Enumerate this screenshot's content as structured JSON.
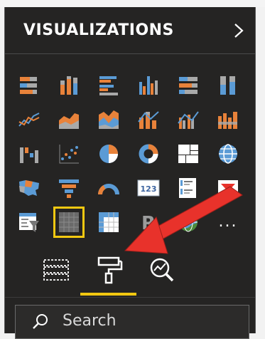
{
  "panel": {
    "title": "VISUALIZATIONS",
    "collapse_icon": "chevron-right-icon"
  },
  "visuals": [
    {
      "name": "stacked-bar-chart-icon"
    },
    {
      "name": "stacked-column-chart-icon"
    },
    {
      "name": "clustered-bar-chart-icon"
    },
    {
      "name": "clustered-column-chart-icon"
    },
    {
      "name": "100-percent-stacked-bar-chart-icon"
    },
    {
      "name": "100-percent-stacked-column-chart-icon"
    },
    {
      "name": "line-chart-icon"
    },
    {
      "name": "area-chart-icon"
    },
    {
      "name": "stacked-area-chart-icon"
    },
    {
      "name": "line-and-stacked-column-chart-icon"
    },
    {
      "name": "line-and-clustered-column-chart-icon"
    },
    {
      "name": "ribbon-chart-icon"
    },
    {
      "name": "waterfall-chart-icon"
    },
    {
      "name": "scatter-chart-icon"
    },
    {
      "name": "pie-chart-icon"
    },
    {
      "name": "donut-chart-icon"
    },
    {
      "name": "treemap-icon"
    },
    {
      "name": "map-icon"
    },
    {
      "name": "filled-map-icon"
    },
    {
      "name": "funnel-icon"
    },
    {
      "name": "gauge-icon"
    },
    {
      "name": "card-icon",
      "text": "123"
    },
    {
      "name": "multi-row-card-icon"
    },
    {
      "name": "kpi-icon"
    },
    {
      "name": "slicer-icon"
    },
    {
      "name": "table-icon",
      "selected": true
    },
    {
      "name": "matrix-icon"
    },
    {
      "name": "r-script-visual-icon",
      "text": "R"
    },
    {
      "name": "arcgis-map-icon"
    },
    {
      "name": "more-visuals-icon",
      "text": "..."
    }
  ],
  "tabs": [
    {
      "name": "fields-icon"
    },
    {
      "name": "format-paint-roller-icon",
      "active": true
    },
    {
      "name": "analytics-icon"
    }
  ],
  "search": {
    "placeholder": "Search",
    "icon": "search-icon"
  },
  "annotation": {
    "type": "arrow",
    "color": "#e8322b",
    "points_to": "format-paint-roller-icon"
  },
  "colors": {
    "panel_bg": "#252423",
    "accent_yellow": "#f2c811",
    "series_orange": "#e8823a",
    "series_blue": "#5b9bd5",
    "arrow_red": "#e8322b"
  }
}
